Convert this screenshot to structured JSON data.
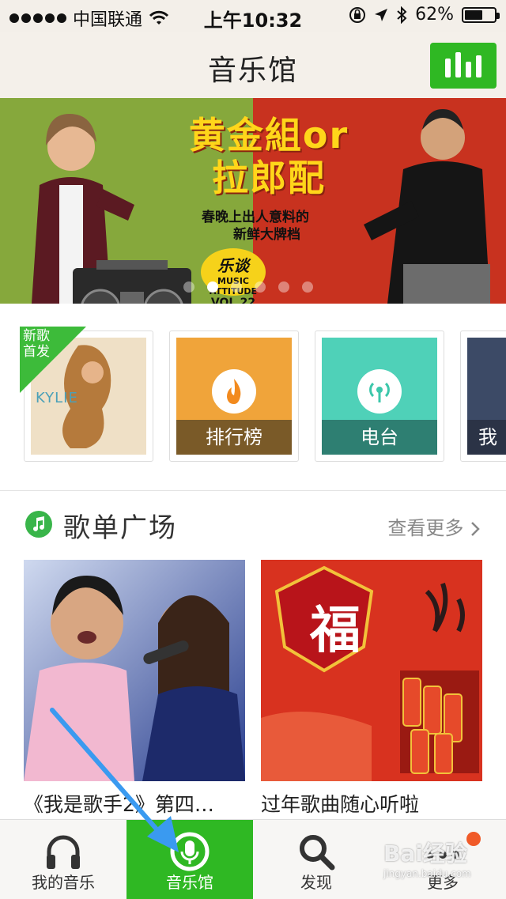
{
  "status_bar": {
    "carrier": "中国联通",
    "time": "上午10:32",
    "battery": "62%",
    "battery_level": 0.62,
    "signal_icon": "signal-dots-icon",
    "wifi_icon": "wifi-icon",
    "lock_icon": "rotation-lock-icon",
    "location_icon": "location-arrow-icon",
    "bluetooth_icon": "bluetooth-icon"
  },
  "nav": {
    "title": "音乐馆",
    "right_icon": "equalizer-icon"
  },
  "banner": {
    "headline_line1": "黄金組",
    "headline_or": "or",
    "headline_line2": "拉郎配",
    "subline1": "春晚上出人意料的",
    "subline2": "新鲜大牌档",
    "badge_logo": "乐谈",
    "badge_sub": "MUSIC ATTITUDE",
    "badge_vol": "VOL.22",
    "page_count": 6,
    "active_page": 2
  },
  "quick_tiles": [
    {
      "ribbon": [
        "新歌",
        "首发"
      ],
      "album_text": "KYLIE"
    },
    {
      "label": "排行榜",
      "icon": "flame-icon",
      "color": "#f0a43a",
      "label_bg": "#7a5a28"
    },
    {
      "label": "电台",
      "icon": "radio-broadcast-icon",
      "color": "#4fd1b8",
      "label_bg": "#2e7f72"
    },
    {
      "label": "我",
      "color": "#3c4a66",
      "label_bg": "#2b3346"
    }
  ],
  "section": {
    "title": "歌单广场",
    "more": "查看更多",
    "icon": "music-note-icon",
    "more_icon": "chevron-right-icon"
  },
  "playlists": [
    {
      "name": "《我是歌手2》第四…"
    },
    {
      "name": "过年歌曲随心听啦",
      "cover_text": "福"
    }
  ],
  "tabs": [
    {
      "label": "我的音乐",
      "icon": "headphones-icon",
      "active": false
    },
    {
      "label": "音乐馆",
      "icon": "music-hall-icon",
      "active": true
    },
    {
      "label": "发现",
      "icon": "search-icon",
      "active": false
    },
    {
      "label": "更多",
      "icon": "more-dots-icon",
      "active": false
    }
  ],
  "watermark": {
    "text": "Bai经验",
    "sub": "jingyan.baidu.com"
  },
  "colors": {
    "accent_green": "#2fb823",
    "banner_left": "#86a83c",
    "banner_right": "#c8321f",
    "headline": "#ffd61a",
    "notification": "#f05a28"
  }
}
